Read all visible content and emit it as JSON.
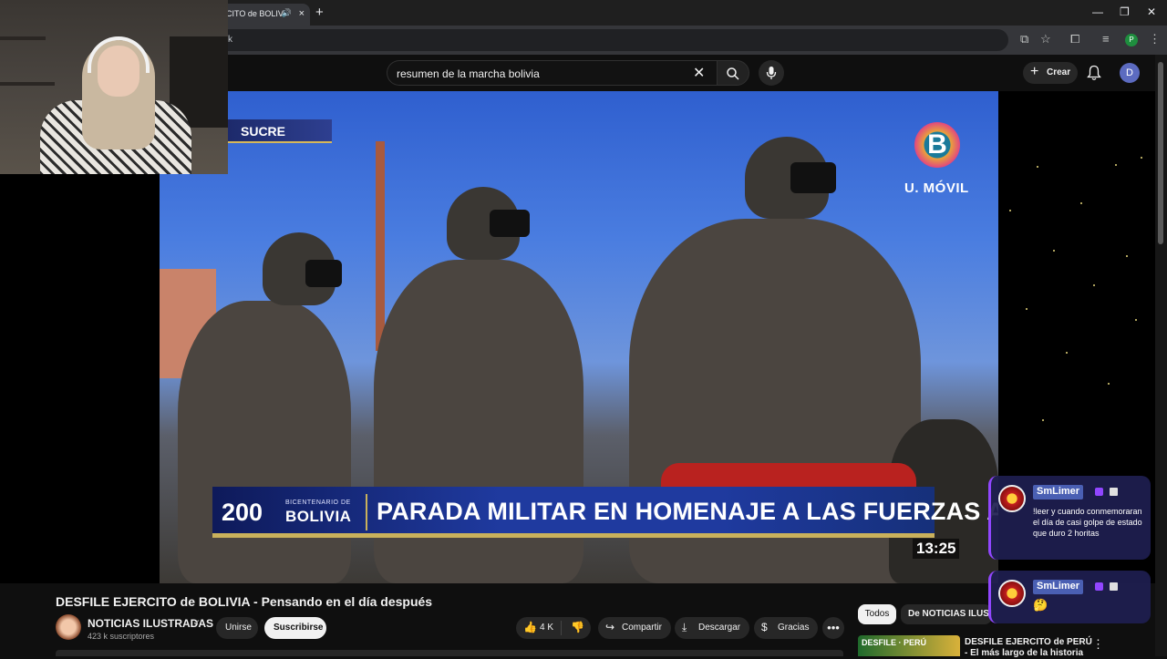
{
  "browser": {
    "tab_title": "CITO de BOLIV",
    "new_tab_symbol": "+",
    "close_symbol": "×",
    "omnibox_text": "k",
    "profile_initial": "P",
    "window_minimize": "—",
    "window_restore": "❐",
    "window_close": "✕"
  },
  "youtube_header": {
    "search_value": "resumen de la marcha bolivia",
    "clear_symbol": "✕",
    "create_label": "Crear",
    "create_symbol": "+",
    "avatar_initial": "D"
  },
  "video": {
    "location_tag": "SUCRE",
    "channel_logo_letter": "B",
    "channel_logo_text": "U. MÓVIL",
    "lower_third_number": "200",
    "lower_third_small": "BICENTENARIO DE",
    "lower_third_country": "BOLIVIA",
    "headline": "PARADA MILITAR EN HOMENAJE A LAS FUERZAS ARMADAS",
    "timestamp": "13:25"
  },
  "video_info": {
    "title": "DESFILE EJERCITO de BOLIVIA - Pensando en el día después",
    "channel_name": "NOTICIAS ILUSTRADAS",
    "verified_symbol": "✔",
    "subscribers": "423 k suscriptores",
    "join_label": "Unirse",
    "subscribe_label": "Suscribirse",
    "like_count": "4 K",
    "share_label": "Compartir",
    "download_label": "Descargar",
    "thanks_label": "Gracias",
    "more_symbol": "•••"
  },
  "sidebar": {
    "chip_all": "Todos",
    "chip_channel": "De NOTICIAS ILUSTRADAS",
    "rec_thumb_text": "DESFILE · PERÚ",
    "rec_title": "DESFILE EJERCITO de PERÚ - El más largo de la historia",
    "rec_menu_symbol": "⋮"
  },
  "chat": {
    "messages": [
      {
        "user": "SmLimer",
        "text": "!leer y cuando conmemoraran el día de casi golpe de estado que duro 2 horitas"
      },
      {
        "user": "SmLimer",
        "text": "🤔"
      }
    ]
  }
}
